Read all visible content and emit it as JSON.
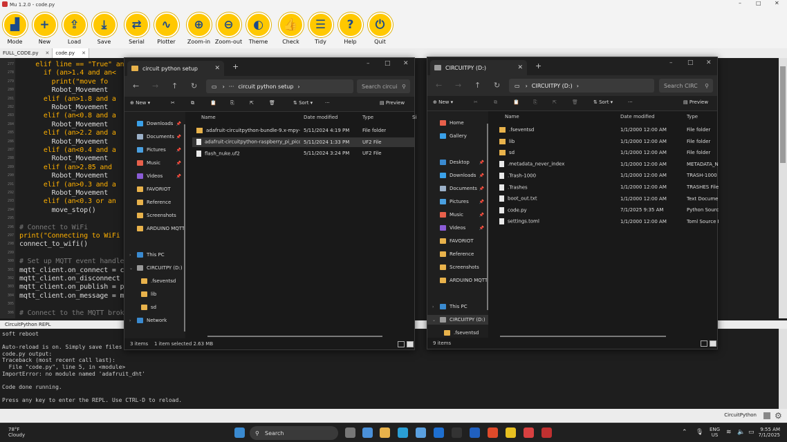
{
  "mu": {
    "window_title": "Mu 1.2.0 - code.py",
    "window_controls": [
      "–",
      "□",
      "✕"
    ],
    "toolbar": [
      {
        "label": "Mode",
        "glyph": "▟",
        "name": "mode"
      },
      {
        "label": "New",
        "glyph": "+",
        "name": "new"
      },
      {
        "label": "Load",
        "glyph": "⇪",
        "name": "load"
      },
      {
        "label": "Save",
        "glyph": "⤓",
        "name": "save"
      },
      {
        "label": "Serial",
        "glyph": "⇄",
        "name": "serial"
      },
      {
        "label": "Plotter",
        "glyph": "∿",
        "name": "plotter"
      },
      {
        "label": "Zoom-in",
        "glyph": "⊕",
        "name": "zoom-in"
      },
      {
        "label": "Zoom-out",
        "glyph": "⊖",
        "name": "zoom-out"
      },
      {
        "label": "Theme",
        "glyph": "◐",
        "name": "theme"
      },
      {
        "label": "Check",
        "glyph": "👍",
        "name": "check"
      },
      {
        "label": "Tidy",
        "glyph": "☰",
        "name": "tidy"
      },
      {
        "label": "Help",
        "glyph": "?",
        "name": "help"
      },
      {
        "label": "Quit",
        "glyph": "⏻",
        "name": "quit"
      }
    ],
    "tabs": [
      {
        "label": "FULL_CODE.py",
        "close": "✕"
      },
      {
        "label": "code.py",
        "close": "✕"
      }
    ],
    "code_lines": [
      {
        "n": "277",
        "t": "    elif line == \"True\" and"
      },
      {
        "n": "278",
        "t": "      if (an>1.4 and an<"
      },
      {
        "n": "279",
        "t": "        print(\"move fo"
      },
      {
        "n": "280",
        "t": "        Robot_Movement"
      },
      {
        "n": "281",
        "t": "      elif (an>1.8 and a"
      },
      {
        "n": "282",
        "t": "        Robot_Movement"
      },
      {
        "n": "283",
        "t": "      elif (an<0.8 and a"
      },
      {
        "n": "284",
        "t": "        Robot_Movement"
      },
      {
        "n": "285",
        "t": "      elif (an>2.2 and a"
      },
      {
        "n": "286",
        "t": "        Robot_Movement"
      },
      {
        "n": "287",
        "t": "      elif (an<0.4 and a"
      },
      {
        "n": "288",
        "t": "        Robot_Movement"
      },
      {
        "n": "289",
        "t": "      elif (an>2.85 and"
      },
      {
        "n": "290",
        "t": "        Robot_Movement"
      },
      {
        "n": "291",
        "t": "      elif (an>0.3 and a"
      },
      {
        "n": "292",
        "t": "        Robot_Movement"
      },
      {
        "n": "293",
        "t": "      elif (an<0.3 or an"
      },
      {
        "n": "294",
        "t": "        move_stop()"
      },
      {
        "n": "295",
        "t": ""
      },
      {
        "n": "296",
        "t": "# Connect to WiFi"
      },
      {
        "n": "297",
        "t": "print(\"Connecting to WiFi"
      },
      {
        "n": "298",
        "t": "connect_to_wifi()"
      },
      {
        "n": "299",
        "t": ""
      },
      {
        "n": "300",
        "t": "# Set up MQTT event handle"
      },
      {
        "n": "301",
        "t": "mqtt_client.on_connect = c"
      },
      {
        "n": "302",
        "t": "mqtt_client.on_disconnect"
      },
      {
        "n": "303",
        "t": "mqtt_client.on_publish = p"
      },
      {
        "n": "304",
        "t": "mqtt_client.on_message = m"
      },
      {
        "n": "305",
        "t": ""
      },
      {
        "n": "306",
        "t": "# Connect to the MQTT brok"
      }
    ],
    "repl_label": "CircuitPython REPL",
    "repl_lines": [
      "soft reboot",
      "",
      "Auto-reload is on. Simply save files ov",
      "code.py output:",
      "Traceback (most recent call last):",
      "  File \"code.py\", line 5, in <module>",
      "ImportError: no module named 'adafruit_dht'",
      "",
      "Code done running.",
      "",
      "Press any key to enter the REPL. Use CTRL-D to reload."
    ],
    "mode_label": "CircuitPython"
  },
  "explorer_left": {
    "tab_title": "circuit python setup",
    "address": "circuit python setup",
    "search_placeholder": "Search circui",
    "new_label": "New",
    "sort_label": "Sort",
    "preview_label": "Preview",
    "more_label": "···",
    "nav_items": [
      {
        "label": "Downloads",
        "pin": true,
        "color": "#3aa0e8",
        "indent": 0
      },
      {
        "label": "Documents",
        "pin": true,
        "color": "#9bb0c8",
        "indent": 0
      },
      {
        "label": "Pictures",
        "pin": true,
        "color": "#4aa0e0",
        "indent": 0
      },
      {
        "label": "Music",
        "pin": true,
        "color": "#e8604b",
        "indent": 0
      },
      {
        "label": "Videos",
        "pin": true,
        "color": "#8b5cd6",
        "indent": 0
      },
      {
        "label": "FAVORIOT",
        "pin": false,
        "color": "#e8b24b",
        "indent": 0
      },
      {
        "label": "Reference",
        "pin": false,
        "color": "#e8b24b",
        "indent": 0
      },
      {
        "label": "Screenshots",
        "pin": false,
        "color": "#e8b24b",
        "indent": 0
      },
      {
        "label": "ARDUINO MQTT",
        "pin": false,
        "color": "#e8b24b",
        "indent": 0
      },
      {
        "label": "",
        "pin": false,
        "color": "",
        "indent": 0
      },
      {
        "label": "This PC",
        "pin": false,
        "color": "#3a8ad0",
        "indent": 0
      },
      {
        "label": "CIRCUITPY (D:)",
        "pin": false,
        "color": "#9a9a9a",
        "indent": 0
      },
      {
        "label": ".fseventsd",
        "pin": false,
        "color": "#e8b24b",
        "indent": 1
      },
      {
        "label": "lib",
        "pin": false,
        "color": "#e8b24b",
        "indent": 1
      },
      {
        "label": "sd",
        "pin": false,
        "color": "#e8b24b",
        "indent": 1
      },
      {
        "label": "Network",
        "pin": false,
        "color": "#3a8ad0",
        "indent": 0
      }
    ],
    "columns": [
      "Name",
      "Date modified",
      "Type",
      "Si"
    ],
    "files": [
      {
        "name": "adafruit-circuitpython-bundle-9.x-mpy-...",
        "date": "5/11/2024 4:19 PM",
        "type": "File folder",
        "kind": "folder"
      },
      {
        "name": "adafruit-circuitpython-raspberry_pi_pico...",
        "date": "5/11/2024 1:33 PM",
        "type": "UF2 File",
        "kind": "file"
      },
      {
        "name": "flash_nuke.uf2",
        "date": "5/11/2024 3:24 PM",
        "type": "UF2 File",
        "kind": "file"
      }
    ],
    "status_items": "3 items",
    "status_selected": "1 item selected  2.63 MB"
  },
  "explorer_right": {
    "tab_title": "CIRCUITPY (D:)",
    "address": "CIRCUITPY (D:)",
    "search_placeholder": "Search CIRC",
    "new_label": "New",
    "sort_label": "Sort",
    "preview_label": "Preview",
    "more_label": "···",
    "nav_items": [
      {
        "label": "Home",
        "color": "#e8604b"
      },
      {
        "label": "Gallery",
        "color": "#3aa0e8"
      },
      {
        "label": "",
        "color": ""
      },
      {
        "label": "Desktop",
        "color": "#3a8ad0"
      },
      {
        "label": "Downloads",
        "color": "#3aa0e8"
      },
      {
        "label": "Documents",
        "color": "#9bb0c8"
      },
      {
        "label": "Pictures",
        "color": "#4aa0e0"
      },
      {
        "label": "Music",
        "color": "#e8604b"
      },
      {
        "label": "Videos",
        "color": "#8b5cd6"
      },
      {
        "label": "FAVORIOT",
        "color": "#e8b24b"
      },
      {
        "label": "Reference",
        "color": "#e8b24b"
      },
      {
        "label": "Screenshots",
        "color": "#e8b24b"
      },
      {
        "label": "ARDUINO MQTT",
        "color": "#e8b24b"
      },
      {
        "label": "",
        "color": ""
      },
      {
        "label": "This PC",
        "color": "#3a8ad0"
      },
      {
        "label": "CIRCUITPY (D:)",
        "color": "#9a9a9a"
      },
      {
        "label": ".fseventsd",
        "color": "#e8b24b"
      }
    ],
    "columns": [
      "Name",
      "Date modified",
      "Type"
    ],
    "files": [
      {
        "name": ".fseventsd",
        "date": "1/1/2000 12:00 AM",
        "type": "File folder",
        "kind": "folder"
      },
      {
        "name": "lib",
        "date": "1/1/2000 12:00 AM",
        "type": "File folder",
        "kind": "folder"
      },
      {
        "name": "sd",
        "date": "1/1/2000 12:00 AM",
        "type": "File folder",
        "kind": "folder"
      },
      {
        "name": ".metadata_never_index",
        "date": "1/1/2000 12:00 AM",
        "type": "METADATA_NE",
        "kind": "file"
      },
      {
        "name": ".Trash-1000",
        "date": "1/1/2000 12:00 AM",
        "type": "TRASH-1000 Fi",
        "kind": "file"
      },
      {
        "name": ".Trashes",
        "date": "1/1/2000 12:00 AM",
        "type": "TRASHES File",
        "kind": "file"
      },
      {
        "name": "boot_out.txt",
        "date": "1/1/2000 12:00 AM",
        "type": "Text Documen",
        "kind": "file"
      },
      {
        "name": "code.py",
        "date": "7/1/2025 9:35 AM",
        "type": "Python Source",
        "kind": "file"
      },
      {
        "name": "settings.toml",
        "date": "1/1/2000 12:00 AM",
        "type": "Toml Source Fi",
        "kind": "file"
      }
    ],
    "status_items": "9 items"
  },
  "taskbar": {
    "weather_temp": "78°F",
    "weather_desc": "Cloudy",
    "search_label": "Search",
    "lang_1": "ENG",
    "lang_2": "US",
    "time": "9:55 AM",
    "date": "7/1/2025"
  }
}
